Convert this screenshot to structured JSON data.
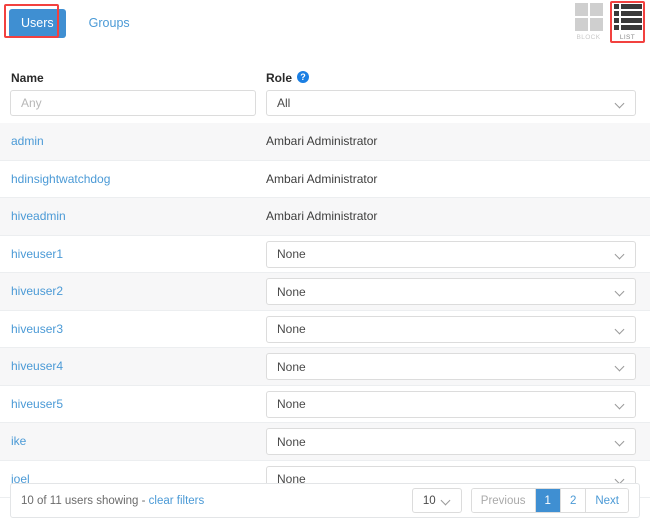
{
  "tabs": [
    {
      "label": "Users",
      "active": true
    },
    {
      "label": "Groups",
      "active": false
    }
  ],
  "view_toggle": {
    "block": {
      "label": "BLOCK",
      "icon": "block-grid-icon",
      "active": false
    },
    "list": {
      "label": "LIST",
      "icon": "list-rows-icon",
      "active": true
    }
  },
  "columns": {
    "name_header": "Name",
    "role_header": "Role",
    "role_help_icon": "help-question-icon",
    "role_help_glyph": "?"
  },
  "filters": {
    "name_value": "",
    "name_placeholder": "Any",
    "role_value": "All"
  },
  "rows": [
    {
      "name": "admin",
      "role": "Ambari Administrator",
      "editable": false
    },
    {
      "name": "hdinsightwatchdog",
      "role": "Ambari Administrator",
      "editable": false
    },
    {
      "name": "hiveadmin",
      "role": "Ambari Administrator",
      "editable": false
    },
    {
      "name": "hiveuser1",
      "role": "None",
      "editable": true
    },
    {
      "name": "hiveuser2",
      "role": "None",
      "editable": true
    },
    {
      "name": "hiveuser3",
      "role": "None",
      "editable": true
    },
    {
      "name": "hiveuser4",
      "role": "None",
      "editable": true
    },
    {
      "name": "hiveuser5",
      "role": "None",
      "editable": true
    },
    {
      "name": "ike",
      "role": "None",
      "editable": true
    },
    {
      "name": "joel",
      "role": "None",
      "editable": true
    }
  ],
  "footer": {
    "status_text": "10 of 11 users showing - ",
    "clear_filters_label": "clear filters",
    "page_size": "10",
    "pager": [
      {
        "label": "Previous",
        "state": "disabled"
      },
      {
        "label": "1",
        "state": "active"
      },
      {
        "label": "2",
        "state": "normal"
      },
      {
        "label": "Next",
        "state": "normal"
      }
    ]
  },
  "colors": {
    "accent_blue": "#3f8fd2",
    "link_blue": "#4b9ad6",
    "highlight_red": "#f2413f",
    "row_stripe": "#f7f7f8"
  }
}
